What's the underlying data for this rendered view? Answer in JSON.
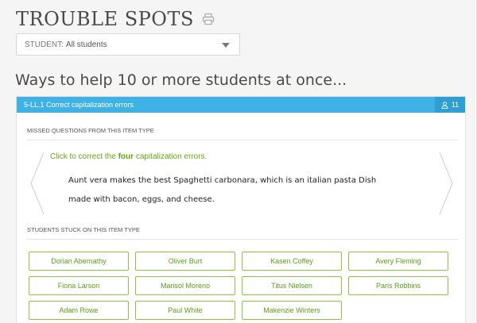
{
  "page": {
    "title": "TROUBLE SPOTS",
    "print_icon": "printer-icon"
  },
  "filter": {
    "label": "STUDENT:",
    "value": "All students"
  },
  "subheading": "Ways to help 10 or more students at once...",
  "card": {
    "skill": "5-LL.1 Correct capitalization errors",
    "student_count": "11",
    "header_color": "#40b1e4",
    "missed_label": "MISSED QUESTIONS FROM THIS ITEM TYPE",
    "prompt_before": "Click to correct the ",
    "prompt_bold": "four",
    "prompt_after": " capitalization errors.",
    "sentence_line1": "Aunt vera makes the best Spaghetti carbonara, which is an italian pasta Dish",
    "sentence_line2": "made with bacon, eggs, and cheese.",
    "stuck_label": "STUDENTS STUCK ON THIS ITEM TYPE",
    "students": [
      "Dorian Abernathy",
      "Oliver Burt",
      "Kasen Coffey",
      "Avery Fleming",
      "Fiona Larson",
      "Marisol Moreno",
      "Titus Nielsen",
      "Paris Robbins",
      "Adam Rowe",
      "Paul White",
      "Makenzie Winters"
    ]
  },
  "colors": {
    "accent_green": "#8cc63f",
    "green_text": "#5d9d18",
    "header_blue": "#40b1e4"
  }
}
